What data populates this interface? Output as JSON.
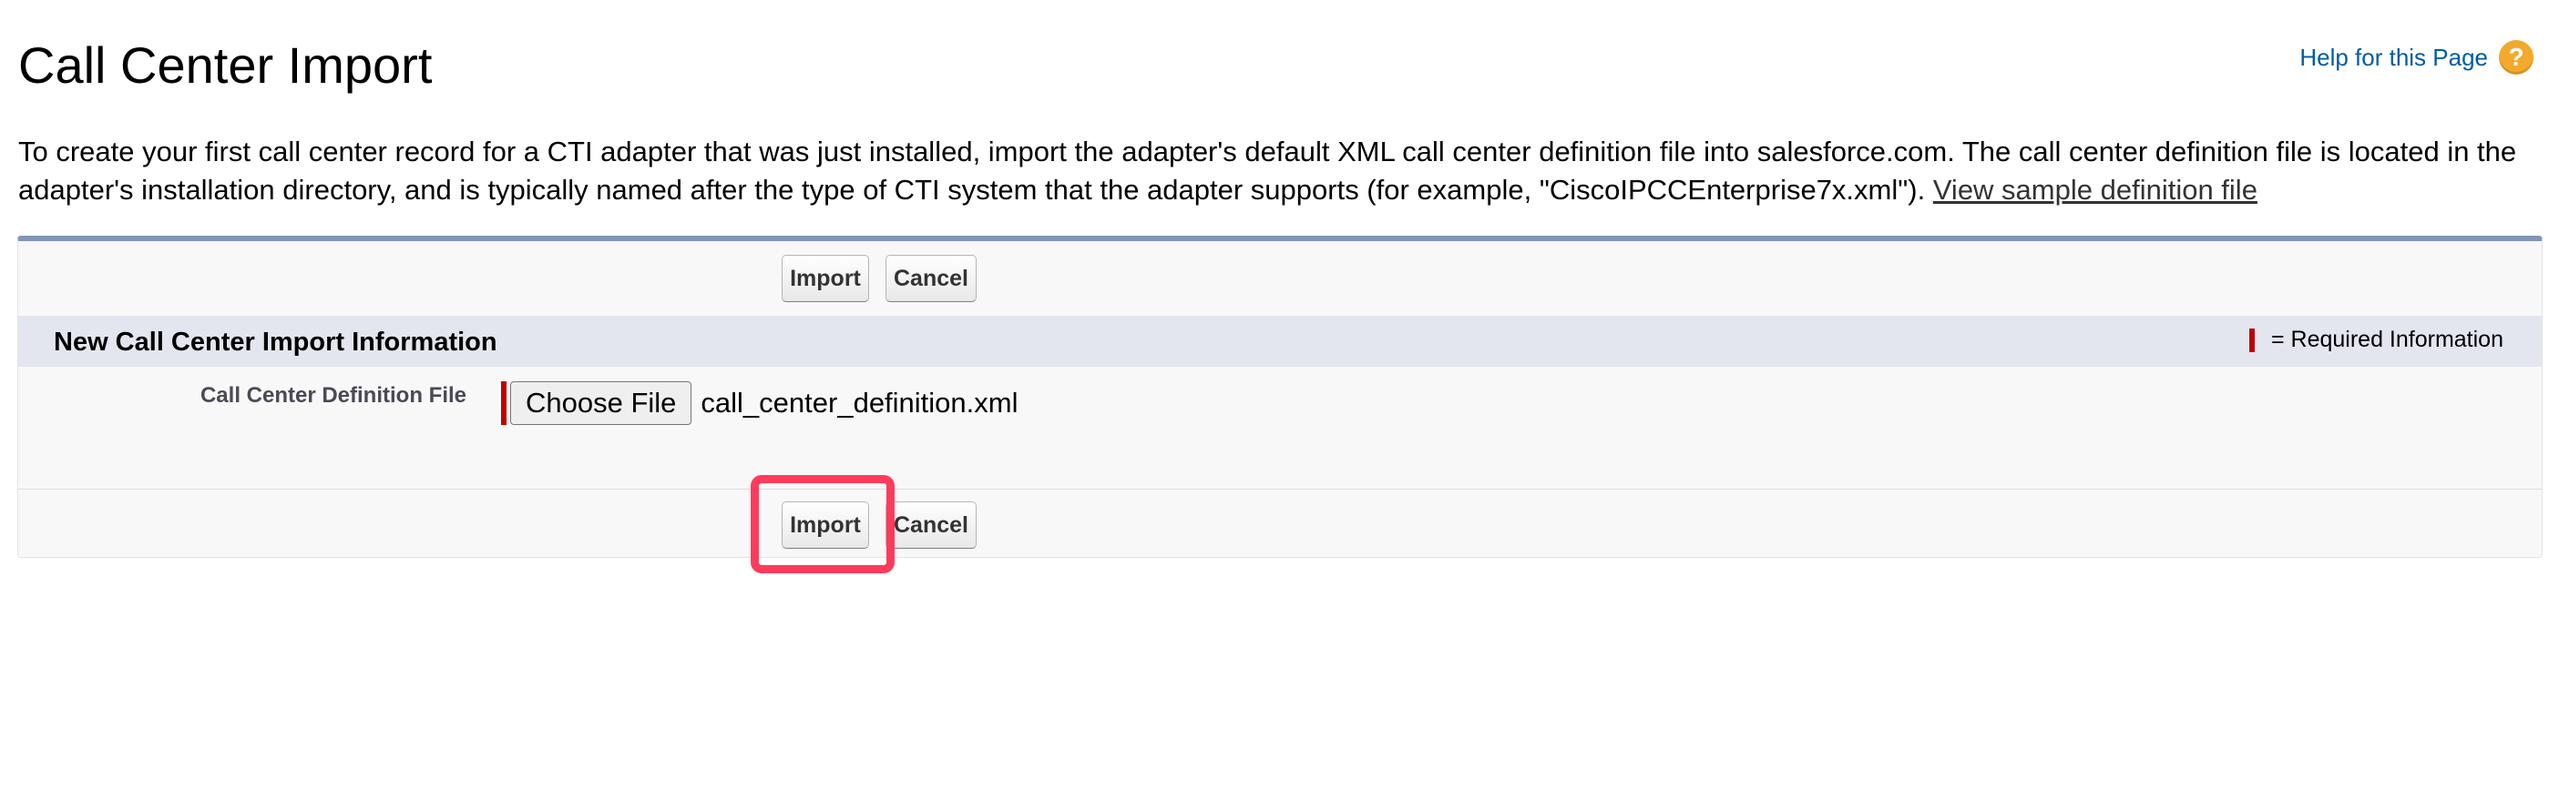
{
  "page": {
    "title": "Call Center Import",
    "help_link": "Help for this Page",
    "help_icon": "help-question-icon",
    "intro_text": "To create your first call center record for a CTI adapter that was just installed, import the adapter's default XML call center definition file into salesforce.com. The call center definition file is located in the adapter's installation directory, and is typically named after the type of CTI system that the adapter supports (for example, \"CiscoIPCCEnterprise7x.xml\"). ",
    "intro_link": "View sample definition file"
  },
  "buttons": {
    "import": "Import",
    "cancel": "Cancel"
  },
  "section": {
    "title": "New Call Center Import Information",
    "required_legend": "= Required Information"
  },
  "form": {
    "definition_file_label": "Call Center Definition File",
    "choose_file_label": "Choose File",
    "selected_file": "call_center_definition.xml"
  },
  "colors": {
    "panel_border_top": "#8095b6",
    "section_header_bg": "#e3e6ee",
    "required": "#c00000",
    "link": "#015ba7",
    "highlight": "#ff3b5c"
  }
}
